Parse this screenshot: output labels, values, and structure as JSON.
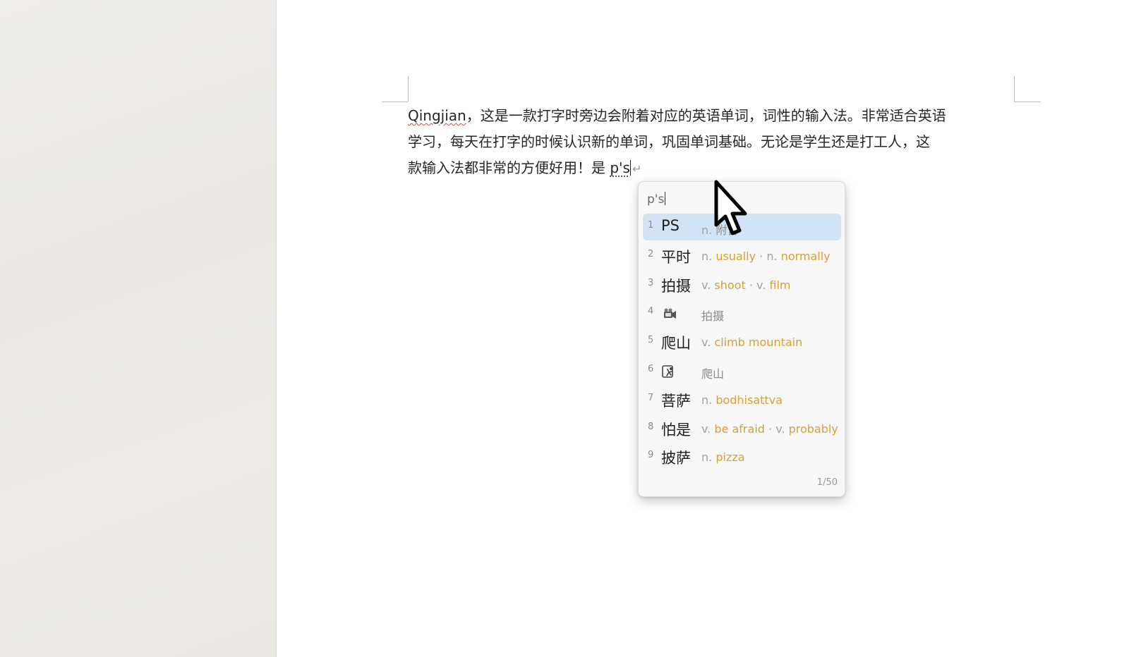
{
  "document": {
    "misspelled_word": "Qingjian",
    "line1_rest": "，这是一款打字时旁边会附着对应的英语单词，词性的输入法。非常适合英语",
    "line2": "学习，每天在打字的时候认识新的单词，巩固单词基础。无论是学生还是打工人，这",
    "line3_prefix": "款输入法都非常的方便好用！是 ",
    "composing": "p's",
    "paragraph_mark": "↵"
  },
  "ime": {
    "input": "p's",
    "page_indicator": "1/50",
    "candidates": [
      {
        "index": "1",
        "word": "PS",
        "gloss": [
          {
            "pos": "n.",
            "meaning": "附言",
            "muted": true
          }
        ],
        "selected": true
      },
      {
        "index": "2",
        "word": "平时",
        "gloss": [
          {
            "pos": "n.",
            "meaning": "usually"
          },
          {
            "pos": "n.",
            "meaning": "normally"
          }
        ]
      },
      {
        "index": "3",
        "word": "拍摄",
        "gloss": [
          {
            "pos": "v.",
            "meaning": "shoot"
          },
          {
            "pos": "v.",
            "meaning": "film"
          }
        ]
      },
      {
        "index": "4",
        "icon": "video-camera-icon",
        "gloss_text": "拍摄"
      },
      {
        "index": "5",
        "word": "爬山",
        "gloss": [
          {
            "pos": "v.",
            "meaning": "climb mountain"
          }
        ]
      },
      {
        "index": "6",
        "icon": "climbing-icon",
        "gloss_text": "爬山"
      },
      {
        "index": "7",
        "word": "菩萨",
        "gloss": [
          {
            "pos": "n.",
            "meaning": "bodhisattva"
          }
        ]
      },
      {
        "index": "8",
        "word": "怕是",
        "gloss": [
          {
            "pos": "v.",
            "meaning": "be afraid"
          },
          {
            "pos": "v.",
            "meaning": "probably"
          }
        ]
      },
      {
        "index": "9",
        "word": "披萨",
        "gloss": [
          {
            "pos": "n.",
            "meaning": "pizza"
          }
        ]
      }
    ]
  },
  "colors": {
    "selected_row": "#d3e3f6",
    "meaning_accent": "#d4a13a",
    "sidebar": "#eeebe7"
  }
}
